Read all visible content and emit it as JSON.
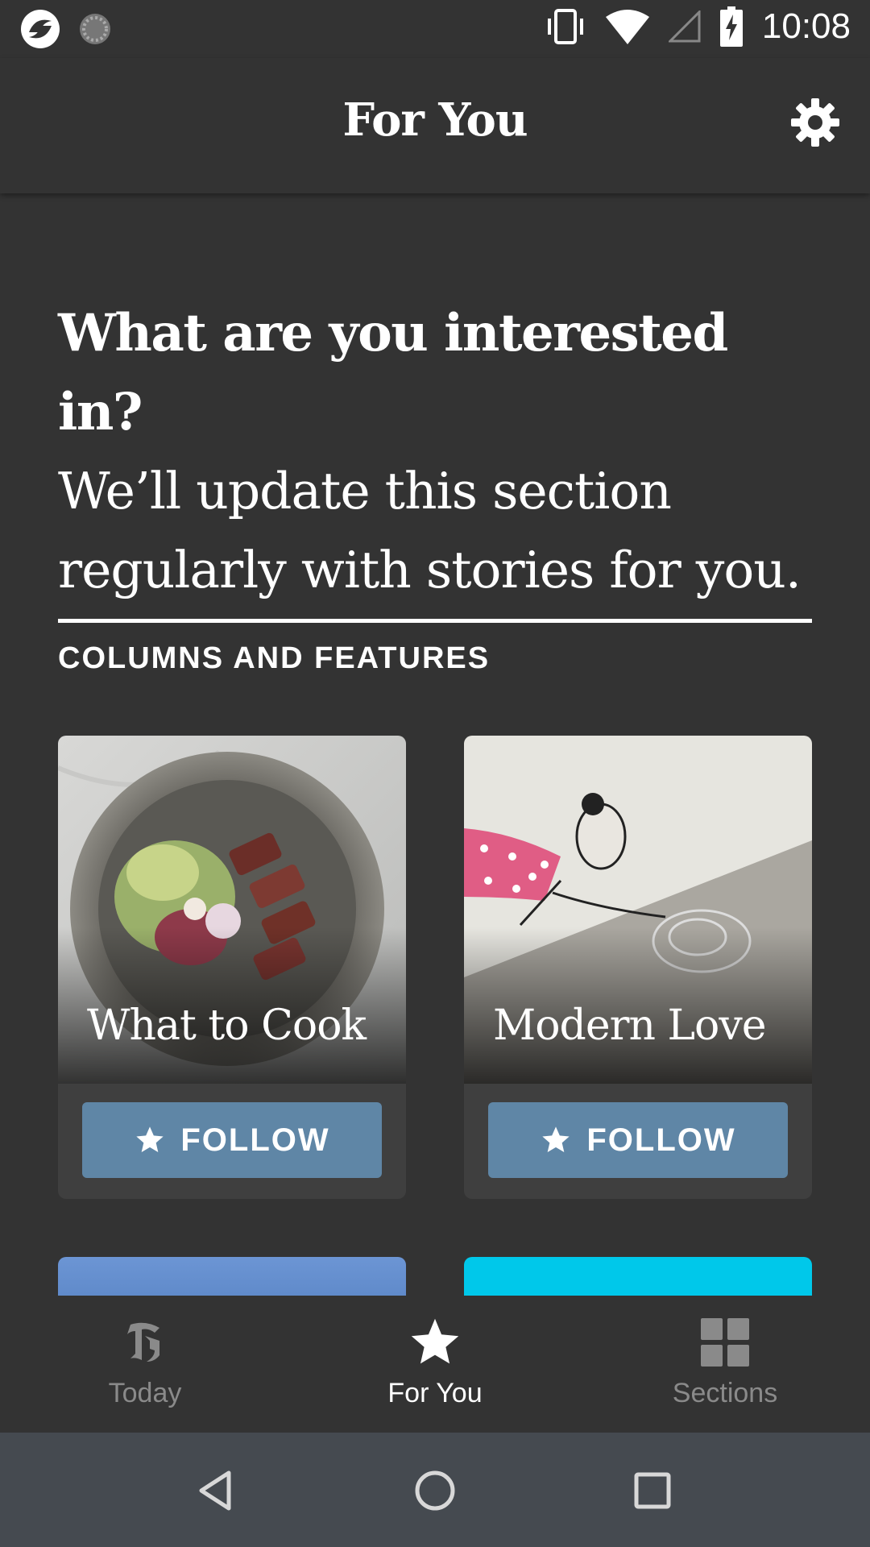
{
  "status_bar": {
    "time": "10:08",
    "icons": [
      "app-notification-icon",
      "sync-icon",
      "vibrate-icon",
      "wifi-icon",
      "cellular-signal-icon",
      "battery-charging-icon"
    ]
  },
  "app_bar": {
    "title": "For You",
    "settings_icon": "gear-icon"
  },
  "intro": {
    "heading": "What are you interested in?",
    "body": "We’ll update this section regularly with stories for you."
  },
  "section": {
    "label": "COLUMNS AND FEATURES"
  },
  "cards": [
    {
      "title": "What to Cook",
      "button_label": "FOLLOW",
      "button_icon": "star-icon"
    },
    {
      "title": "Modern Love",
      "button_label": "FOLLOW",
      "button_icon": "star-icon"
    }
  ],
  "bottom_nav": {
    "items": [
      {
        "label": "Today",
        "icon": "nyt-logo-icon",
        "active": false
      },
      {
        "label": "For You",
        "icon": "star-icon",
        "active": true
      },
      {
        "label": "Sections",
        "icon": "grid-icon",
        "active": false
      }
    ]
  },
  "system_nav": {
    "icons": [
      "back-icon",
      "home-icon",
      "recents-icon"
    ]
  },
  "colors": {
    "background": "#333333",
    "follow_button": "#5f86a6",
    "system_nav": "#454a50"
  }
}
